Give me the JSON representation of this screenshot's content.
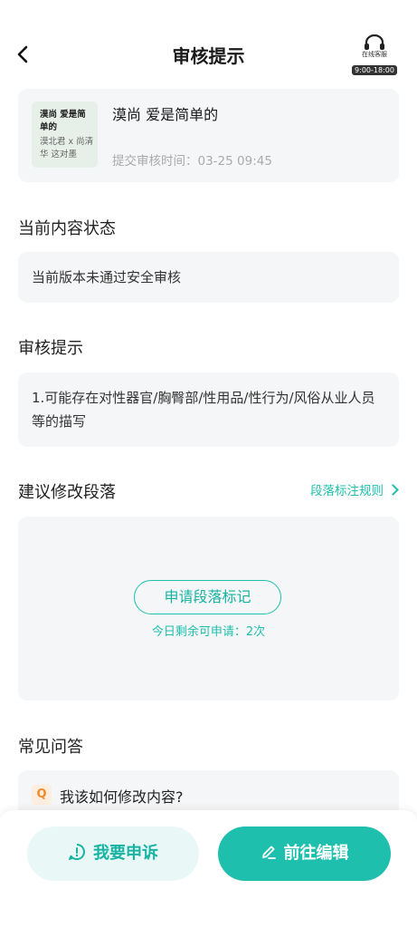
{
  "header": {
    "title": "审核提示",
    "service_label": "在线客服",
    "service_hours": "9:00-18:00"
  },
  "book": {
    "cover_text_top": "漠尚 爱是简单的",
    "cover_text_bottom": "漠北君 x 尚清华 这对墨",
    "title": "漠尚 爱是简单的",
    "submit_time": "提交审核时间：03-25 09:45"
  },
  "status": {
    "heading": "当前内容状态",
    "text": "当前版本未通过安全审核"
  },
  "review": {
    "heading": "审核提示",
    "text": "1.可能存在对性器官/胸臀部/性用品/性行为/风俗从业人员等的描写"
  },
  "suggest": {
    "heading": "建议修改段落",
    "rules_link": "段落标注规则",
    "apply_button": "申请段落标记",
    "remaining": "今日剩余可申请：2次"
  },
  "faq": {
    "heading": "常见问答",
    "badge": "Q",
    "question": "我该如何修改内容?"
  },
  "actions": {
    "appeal": "我要申诉",
    "edit": "前往编辑"
  },
  "colors": {
    "accent": "#1fbfae",
    "card_bg": "#f5f6f7",
    "appeal_bg": "#e9f8f6"
  }
}
